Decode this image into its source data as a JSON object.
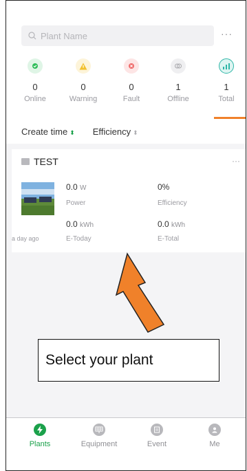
{
  "search": {
    "placeholder": "Plant Name",
    "more": "···"
  },
  "stats": [
    {
      "count": "0",
      "label": "Online",
      "color": "#2ebd59",
      "bg": "#dff5e6"
    },
    {
      "count": "0",
      "label": "Warning",
      "color": "#f2c12e",
      "bg": "#fdf4d9"
    },
    {
      "count": "0",
      "label": "Fault",
      "color": "#ef6b6b",
      "bg": "#fde5e5"
    },
    {
      "count": "1",
      "label": "Offline",
      "color": "#a9a9ad",
      "bg": "#efeff1"
    },
    {
      "count": "1",
      "label": "Total",
      "color": "#2eb6a7",
      "bg": "#def5f2"
    }
  ],
  "sort": {
    "create_time": "Create time",
    "efficiency": "Efficiency"
  },
  "plant": {
    "name": "TEST",
    "more": "···",
    "power_value": "0.0",
    "power_unit": "W",
    "power_label": "Power",
    "efficiency_value": "0%",
    "efficiency_label": "Efficiency",
    "etoday_value": "0.0",
    "etoday_unit": "kWh",
    "etoday_label": "E-Today",
    "etotal_value": "0.0",
    "etotal_unit": "kWh",
    "etotal_label": "E-Total",
    "updated": "a day ago"
  },
  "callout": {
    "text": "Select your plant"
  },
  "colors": {
    "accent": "#1ba14b",
    "arrow": "#f0812a",
    "tab_indicator": "#f0812a"
  },
  "tabs": [
    {
      "label": "Plants",
      "icon": "bolt-icon",
      "active": true
    },
    {
      "label": "Equipment",
      "icon": "solar-panel-icon",
      "active": false
    },
    {
      "label": "Event",
      "icon": "document-icon",
      "active": false
    },
    {
      "label": "Me",
      "icon": "user-icon",
      "active": false
    }
  ]
}
